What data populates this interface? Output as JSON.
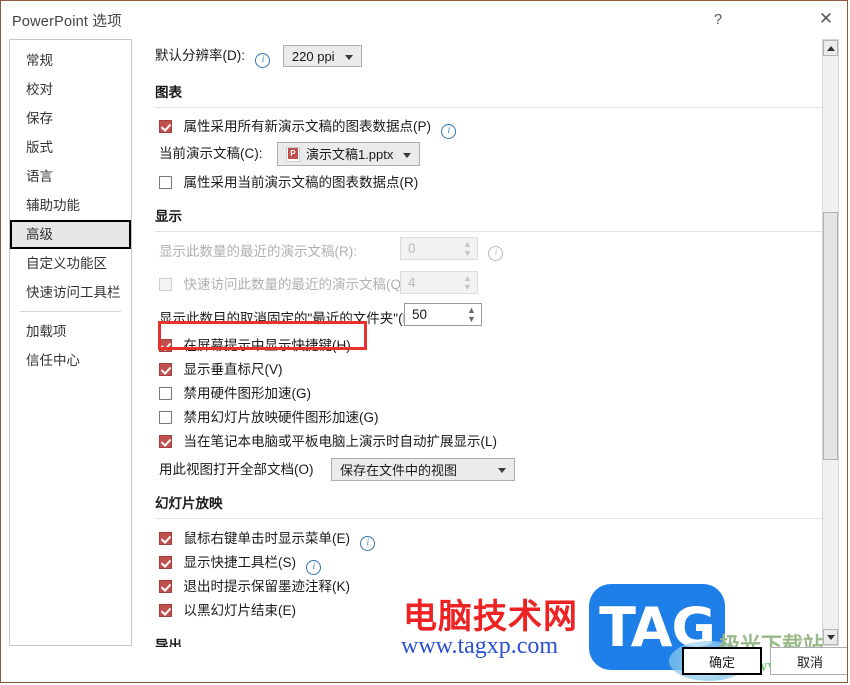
{
  "window": {
    "title": "PowerPoint 选项",
    "help_icon": "?",
    "close_icon": "✕"
  },
  "sidebar": {
    "items": [
      {
        "label": "常规",
        "selected": false
      },
      {
        "label": "校对",
        "selected": false
      },
      {
        "label": "保存",
        "selected": false
      },
      {
        "label": "版式",
        "selected": false
      },
      {
        "label": "语言",
        "selected": false
      },
      {
        "label": "辅助功能",
        "selected": false
      },
      {
        "label": "高级",
        "selected": true
      },
      {
        "label": "自定义功能区",
        "selected": false
      },
      {
        "label": "快速访问工具栏",
        "selected": false
      },
      {
        "label": "加载项",
        "selected": false
      },
      {
        "label": "信任中心",
        "selected": false
      }
    ]
  },
  "content": {
    "resolution": {
      "label": "默认分辨率(D):",
      "value": "220 ppi"
    },
    "chart_section": {
      "heading": "图表",
      "checkbox_all": {
        "label": "属性采用所有新演示文稿的图表数据点(P)",
        "checked": true
      },
      "current_presentation": {
        "label": "当前演示文稿(C):",
        "value": "演示文稿1.pptx",
        "icon": "powerpoint-file-icon"
      },
      "checkbox_current": {
        "label": "属性采用当前演示文稿的图表数据点(R)",
        "checked": false
      }
    },
    "display_section": {
      "heading": "显示",
      "recent_presentations": {
        "label": "显示此数量的最近的演示文稿(R):",
        "value": "0",
        "disabled": true
      },
      "quick_access_recent": {
        "label": "快速访问此数量的最近的演示文稿(Q):",
        "value": "4",
        "checked": false,
        "disabled": true
      },
      "recent_folders": {
        "label": "显示此数目的取消固定的\"最近的文件夹\"(F):",
        "value": "50",
        "disabled": false
      },
      "checkboxes": [
        {
          "label": "在屏幕提示中显示快捷键(H)",
          "checked": true,
          "highlighted": true
        },
        {
          "label": "显示垂直标尺(V)",
          "checked": true,
          "highlighted": false
        },
        {
          "label": "禁用硬件图形加速(G)",
          "checked": false,
          "highlighted": false
        },
        {
          "label": "禁用幻灯片放映硬件图形加速(G)",
          "checked": false,
          "highlighted": false
        },
        {
          "label": "当在笔记本电脑或平板电脑上演示时自动扩展显示(L)",
          "checked": true,
          "highlighted": false
        }
      ],
      "open_view": {
        "label": "用此视图打开全部文档(O)",
        "value": "保存在文件中的视图"
      }
    },
    "slideshow_section": {
      "heading": "幻灯片放映",
      "checkboxes": [
        {
          "label": "鼠标右键单击时显示菜单(E)",
          "checked": true,
          "info": true
        },
        {
          "label": "显示快捷工具栏(S)",
          "checked": true,
          "info": true
        },
        {
          "label": "退出时提示保留墨迹注释(K)",
          "checked": true,
          "info": false
        },
        {
          "label": "以黑幻灯片结束(E)",
          "checked": true,
          "info": false
        }
      ]
    },
    "export_section": {
      "heading": "导出"
    }
  },
  "footer": {
    "ok_label": "确定",
    "cancel_label": "取消"
  },
  "scrollbar": {
    "up_arrow": "▲",
    "down_arrow": "▼"
  },
  "watermarks": {
    "site_cn": "电脑技术网",
    "site_url": "www.tagxp.com",
    "tag_logo": "TAG",
    "jiguang": "极光下载站",
    "xz7": "www.xz7.com"
  },
  "colors": {
    "checkbox_checked": "#c0504d",
    "highlight_box": "#e8312c",
    "info_icon": "#2e75b6",
    "window_border": "#8a5c3b",
    "selected_nav_bg": "#e6e6e6"
  }
}
